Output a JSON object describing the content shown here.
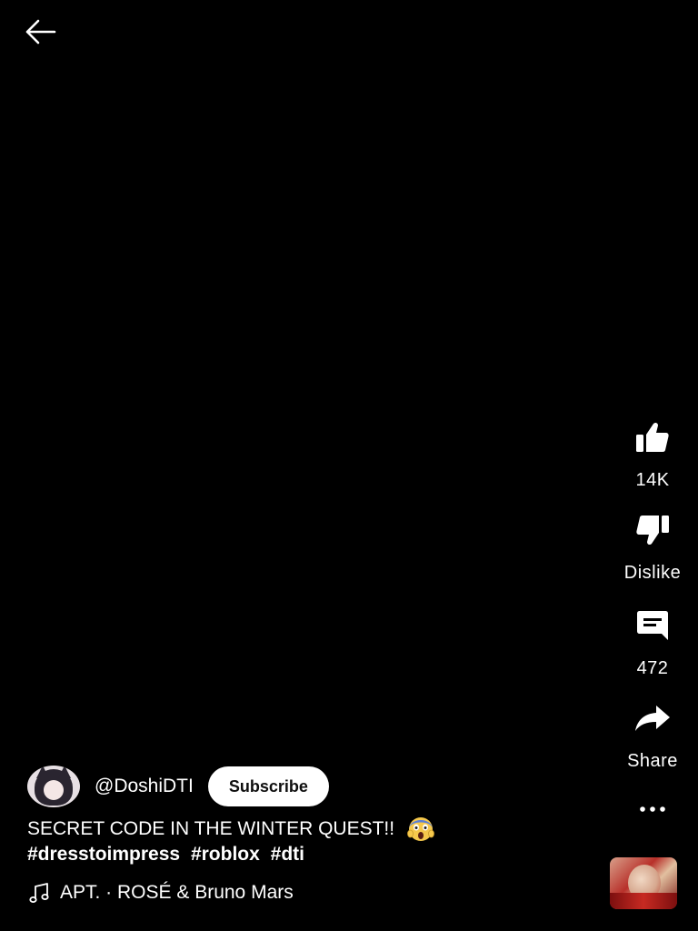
{
  "header": {
    "back_icon": "arrow-left-icon"
  },
  "actions": {
    "like": {
      "icon": "thumb-up-icon",
      "label": "14K"
    },
    "dislike": {
      "icon": "thumb-down-icon",
      "label": "Dislike"
    },
    "comment": {
      "icon": "comment-icon",
      "label": "472"
    },
    "share": {
      "icon": "share-arrow-icon",
      "label": "Share"
    },
    "more": {
      "icon": "more-horizontal-icon"
    }
  },
  "channel": {
    "handle": "@DoshiDTI",
    "subscribe_label": "Subscribe"
  },
  "video": {
    "title": "SECRET CODE IN THE WINTER QUEST!!",
    "title_emoji": "face-screaming-in-fear",
    "hashtags": [
      "#dresstoimpress",
      "#roblox",
      "#dti"
    ]
  },
  "music": {
    "icon": "music-note-icon",
    "text": "APT. · ROSÉ & Bruno Mars"
  },
  "colors": {
    "background": "#000000",
    "text": "#ffffff",
    "subscribe_bg": "#ffffff",
    "subscribe_text": "#0f0f0f"
  }
}
